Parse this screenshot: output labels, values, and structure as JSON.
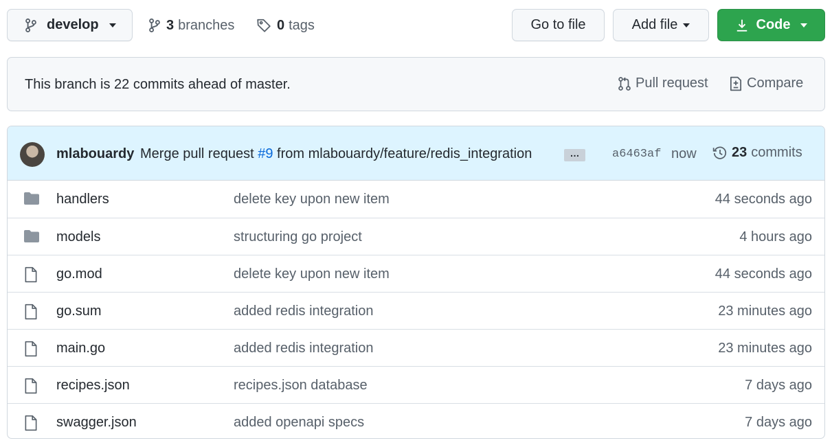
{
  "toolbar": {
    "branch_name": "develop",
    "branches_count": "3",
    "branches_label": "branches",
    "tags_count": "0",
    "tags_label": "tags",
    "goto_label": "Go to file",
    "addfile_label": "Add file",
    "code_label": "Code"
  },
  "banner": {
    "text": "This branch is 22 commits ahead of master.",
    "pr_label": "Pull request",
    "compare_label": "Compare"
  },
  "commit": {
    "author": "mlabouardy",
    "message_prefix": "Merge pull request",
    "pr_ref": "#9",
    "message_suffix": "from mlabouardy/feature/redis_integration",
    "ellipsis": "…",
    "sha": "a6463af",
    "time": "now",
    "commits_count": "23",
    "commits_label": "commits"
  },
  "files": [
    {
      "type": "directory",
      "name": "handlers",
      "commit": "delete key upon new item",
      "age": "44 seconds ago"
    },
    {
      "type": "directory",
      "name": "models",
      "commit": "structuring go project",
      "age": "4 hours ago"
    },
    {
      "type": "file",
      "name": "go.mod",
      "commit": "delete key upon new item",
      "age": "44 seconds ago"
    },
    {
      "type": "file",
      "name": "go.sum",
      "commit": "added redis integration",
      "age": "23 minutes ago"
    },
    {
      "type": "file",
      "name": "main.go",
      "commit": "added redis integration",
      "age": "23 minutes ago"
    },
    {
      "type": "file",
      "name": "recipes.json",
      "commit": "recipes.json database",
      "age": "7 days ago"
    },
    {
      "type": "file",
      "name": "swagger.json",
      "commit": "added openapi specs",
      "age": "7 days ago"
    }
  ],
  "colors": {
    "accent_green": "#2da44e",
    "link_blue": "#0969da",
    "commit_bar_bg": "#ddf4ff",
    "folder_icon": "#54aeff",
    "muted_text": "#57606a"
  }
}
